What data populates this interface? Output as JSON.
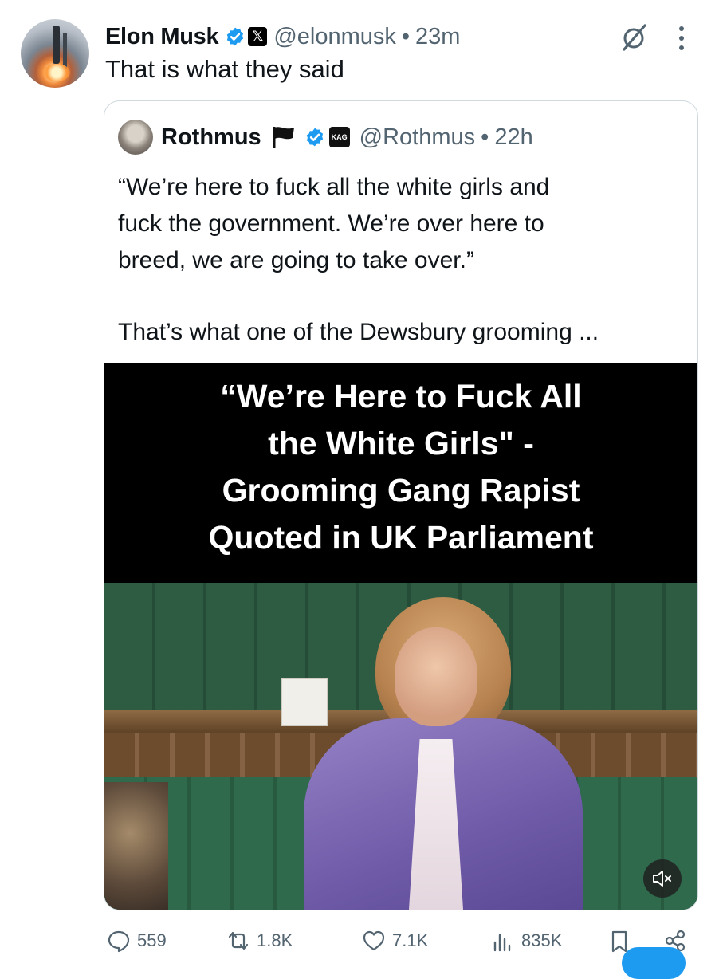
{
  "post": {
    "author_name": "Elon Musk",
    "handle": "@elonmusk",
    "separator": "•",
    "time": "23m",
    "text": "That is what they said",
    "icons": [
      "verified-badge-icon",
      "x-affiliate-badge-icon",
      "grok-icon",
      "more-options-icon"
    ]
  },
  "quote": {
    "author_name": "Rothmus",
    "handle": "@Rothmus",
    "separator": "•",
    "time": "22h",
    "kag_label": "KAG",
    "text_lines": [
      "“We’re here to fuck all the white girls and",
      "fuck the government. We’re over here to",
      "breed, we are going to take over.”"
    ],
    "text_more": "That’s what one of the Dewsbury grooming ...",
    "media": {
      "banner_lines": [
        "“We’re Here to Fuck All",
        "the White Girls\" -",
        "Grooming Gang Rapist",
        "Quoted in UK Parliament"
      ],
      "muted": true
    }
  },
  "actions": {
    "replies": "559",
    "reposts": "1.8K",
    "likes": "7.1K",
    "views": "835K"
  },
  "colors": {
    "secondary_text": "#536471",
    "verified_blue": "#1d9bf0",
    "border": "#cfd9de"
  }
}
